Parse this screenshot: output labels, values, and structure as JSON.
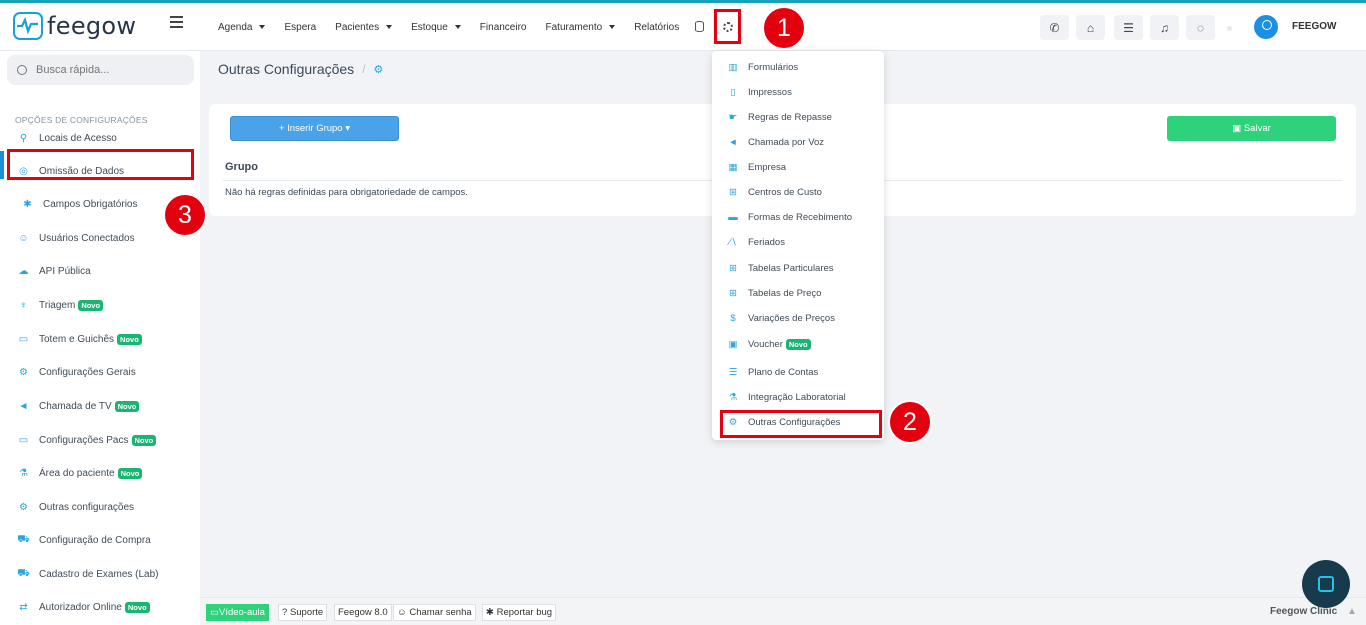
{
  "brand": {
    "logo_text": "feegow",
    "logo_icon": "pulse-icon"
  },
  "nav": {
    "items": [
      {
        "label": "Agenda",
        "dropdown": true
      },
      {
        "label": "Espera",
        "dropdown": false
      },
      {
        "label": "Pacientes",
        "dropdown": true
      },
      {
        "label": "Estoque",
        "dropdown": true
      },
      {
        "label": "Financeiro",
        "dropdown": false
      },
      {
        "label": "Faturamento",
        "dropdown": true
      },
      {
        "label": "Relatórios",
        "dropdown": false
      }
    ]
  },
  "header": {
    "user_name": "FEEGOW",
    "toolbar_icons": [
      "phone-icon",
      "inbox-icon",
      "checklist-icon",
      "bell-icon",
      "chat-icon"
    ]
  },
  "annotations": {
    "step1": "1",
    "step2": "2",
    "step3": "3"
  },
  "sidebar": {
    "search_placeholder": "Busca rápida...",
    "section_title": "OPÇÕES DE CONFIGURAÇÕES",
    "badge_label": "Novo",
    "items": [
      {
        "label": "Locais de Acesso",
        "icon": "location-icon",
        "glyph": "⚲",
        "novo": false
      },
      {
        "label": "Omissão de Dados",
        "icon": "eye-slash-icon",
        "glyph": "◎",
        "novo": false
      },
      {
        "label": "Campos Obrigatórios",
        "icon": "asterisk-icon",
        "glyph": "✱",
        "novo": false
      },
      {
        "label": "Usuários Conectados",
        "icon": "user-icon",
        "glyph": "☺",
        "novo": false
      },
      {
        "label": "API Pública",
        "icon": "cloud-upload-icon",
        "glyph": "☁",
        "novo": false
      },
      {
        "label": "Triagem",
        "icon": "stethoscope-icon",
        "glyph": "♆",
        "novo": true
      },
      {
        "label": "Totem e Guichês",
        "icon": "laptop-icon",
        "glyph": "▭",
        "novo": true
      },
      {
        "label": "Configurações Gerais",
        "icon": "gears-icon",
        "glyph": "⚙",
        "novo": false
      },
      {
        "label": "Chamada de TV",
        "icon": "megaphone-icon",
        "glyph": "◄",
        "novo": true
      },
      {
        "label": "Configurações Pacs",
        "icon": "laptop-icon",
        "glyph": "▭",
        "novo": true
      },
      {
        "label": "Área do paciente",
        "icon": "flask-icon",
        "glyph": "⚗",
        "novo": true
      },
      {
        "label": "Outras configurações",
        "icon": "gears-icon",
        "glyph": "⚙",
        "novo": false
      },
      {
        "label": "Configuração de Compra",
        "icon": "cart-icon",
        "glyph": "⛟",
        "novo": false
      },
      {
        "label": "Cadastro de Exames (Lab)",
        "icon": "cart-icon",
        "glyph": "⛟",
        "novo": false
      },
      {
        "label": "Autorizador Online",
        "icon": "exchange-icon",
        "glyph": "⇄",
        "novo": true
      }
    ]
  },
  "page": {
    "breadcrumb_title": "Outras Configurações",
    "breadcrumb_sep": "/",
    "insert_group_label": "Inserir Grupo",
    "save_label": "Salvar",
    "column_header": "Grupo",
    "empty_message": "Não há regras definidas para obrigatoriedade de campos."
  },
  "settings_menu": {
    "items": [
      {
        "label": "Formulários",
        "icon": "chart-icon",
        "glyph": "▥",
        "novo": false
      },
      {
        "label": "Impressos",
        "icon": "file-icon",
        "glyph": "▯",
        "novo": false
      },
      {
        "label": "Regras de Repasse",
        "icon": "hand-money-icon",
        "glyph": "☛",
        "novo": false
      },
      {
        "label": "Chamada por Voz",
        "icon": "volume-icon",
        "glyph": "◄",
        "novo": false
      },
      {
        "label": "Empresa",
        "icon": "building-icon",
        "glyph": "▦",
        "novo": false
      },
      {
        "label": "Centros de Custo",
        "icon": "sitemap-icon",
        "glyph": "⊞",
        "novo": false
      },
      {
        "label": "Formas de Recebimento",
        "icon": "credit-card-icon",
        "glyph": "▬",
        "novo": false
      },
      {
        "label": "Feriados",
        "icon": "road-icon",
        "glyph": "∕∖",
        "novo": false
      },
      {
        "label": "Tabelas Particulares",
        "icon": "table-icon",
        "glyph": "⊞",
        "novo": false
      },
      {
        "label": "Tabelas de Preço",
        "icon": "table-icon",
        "glyph": "⊞",
        "novo": false
      },
      {
        "label": "Variações de Preços",
        "icon": "dollar-icon",
        "glyph": "$",
        "novo": false
      },
      {
        "label": "Voucher",
        "icon": "ticket-icon",
        "glyph": "▣",
        "novo": true
      },
      {
        "label": "Plano de Contas",
        "icon": "list-indent-icon",
        "glyph": "☰",
        "novo": false
      },
      {
        "label": "Integração Laboratorial",
        "icon": "flask-icon",
        "glyph": "⚗",
        "novo": false
      },
      {
        "label": "Outras Configurações",
        "icon": "gears-icon",
        "glyph": "⚙",
        "novo": false
      }
    ]
  },
  "footer": {
    "video_label": "Vídeo-aula",
    "support_label": "Suporte",
    "version_label": "Feegow 8.0",
    "call_password_label": "Chamar senha",
    "bug_label": "Reportar bug",
    "brand_label": "Feegow Clinic"
  },
  "colors": {
    "accent": "#1aa0d8",
    "annotation": "#e3000f",
    "save": "#2ed27b",
    "insert": "#4aa3e9"
  }
}
